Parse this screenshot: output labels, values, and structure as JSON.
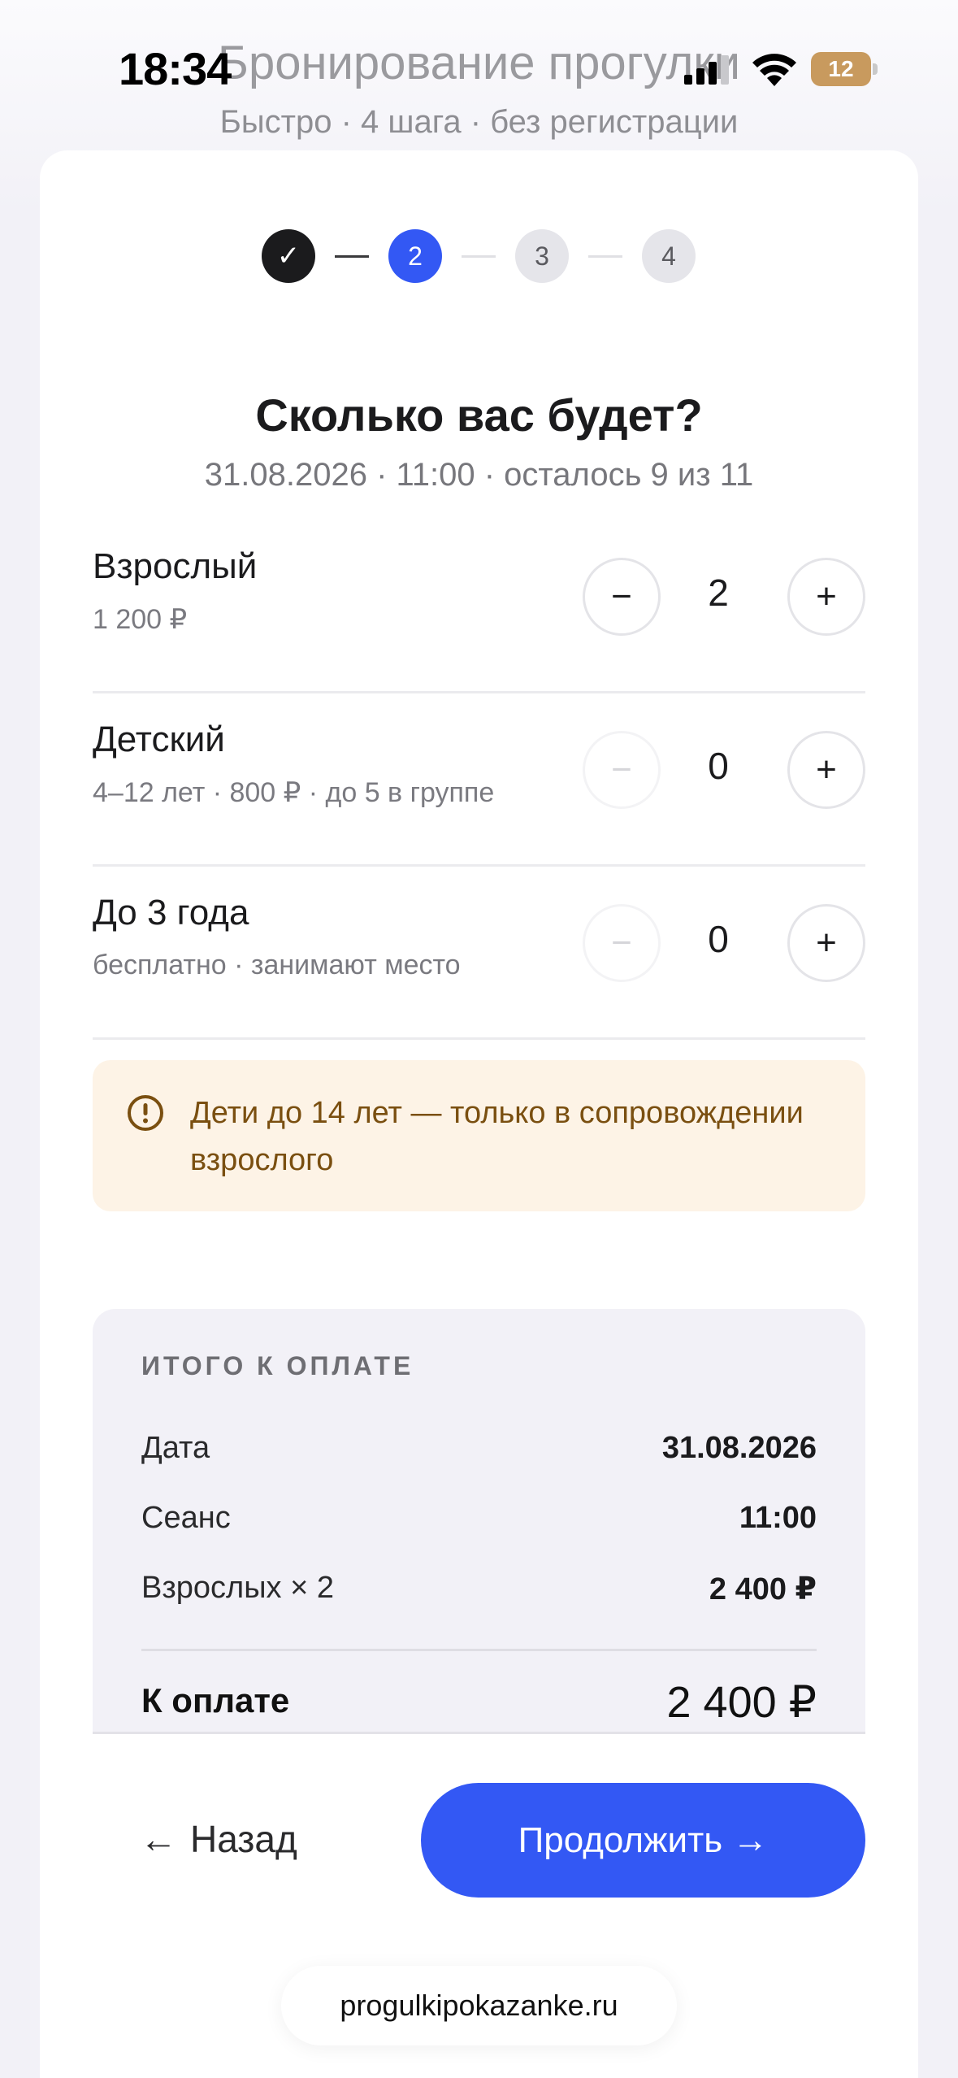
{
  "status_bar": {
    "time": "18:34",
    "battery": "12"
  },
  "header": {
    "title": "Бронирование прогулки",
    "subtitle": "Быстро · 4 шага · без регистрации"
  },
  "steps": [
    {
      "label": "✓",
      "state": "done"
    },
    {
      "label": "2",
      "state": "active"
    },
    {
      "label": "3",
      "state": "todo"
    },
    {
      "label": "4",
      "state": "todo"
    }
  ],
  "question": {
    "title": "Сколько вас будет?",
    "session": "31.08.2026 · 11:00 · осталось 9 из 11"
  },
  "tickets": [
    {
      "name": "Взрослый",
      "desc": "1 200 ₽",
      "count": "2",
      "minus": "−",
      "plus": "+"
    },
    {
      "name": "Детский",
      "desc": "4–12 лет · 800 ₽ · до 5 в группе",
      "count": "0",
      "minus": "−",
      "plus": "+"
    },
    {
      "name": "До 3 года",
      "desc": "бесплатно · занимают место",
      "count": "0",
      "minus": "−",
      "plus": "+"
    }
  ],
  "notice": {
    "text": "Дети до 14 лет — только в сопровождении взрослого",
    "icon": "alert-circle-icon"
  },
  "summary": {
    "title": "ИТОГО К ОПЛАТЕ",
    "rows": [
      {
        "label": "Дата",
        "value": "31.08.2026"
      },
      {
        "label": "Сеанс",
        "value": "11:00"
      },
      {
        "label": "Взрослых × 2",
        "value": "2 400 ₽"
      }
    ],
    "total_label": "К оплате",
    "total_value": "2 400 ₽"
  },
  "actions": {
    "back_arrow": "←",
    "back_label": "Назад",
    "continue_label": "Продолжить →"
  },
  "footer": {
    "url": "progulkipokazanke.ru"
  },
  "colors": {
    "accent": "#3358f4",
    "notice_bg": "#fdf3e6",
    "notice_text": "#7a4f10",
    "battery": "#c89a5e"
  }
}
